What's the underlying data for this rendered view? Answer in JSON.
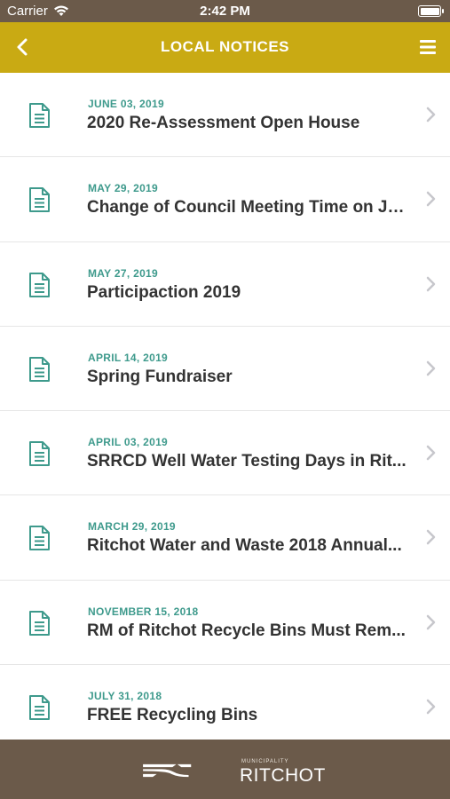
{
  "status_bar": {
    "carrier": "Carrier",
    "time": "2:42 PM"
  },
  "header": {
    "title": "LOCAL NOTICES",
    "back_icon": "chevron-left-icon",
    "menu_icon": "hamburger-menu-icon"
  },
  "notices": [
    {
      "date": "JUNE 03, 2019",
      "title": "2020 Re-Assessment Open House"
    },
    {
      "date": "MAY 29, 2019",
      "title": "Change of Council Meeting Time on Ju..."
    },
    {
      "date": "MAY 27, 2019",
      "title": "Participaction 2019"
    },
    {
      "date": "APRIL 14, 2019",
      "title": "Spring Fundraiser"
    },
    {
      "date": "APRIL 03, 2019",
      "title": "SRRCD Well Water Testing Days in Rit..."
    },
    {
      "date": "MARCH 29, 2019",
      "title": "Ritchot Water and Waste 2018 Annual..."
    },
    {
      "date": "NOVEMBER 15, 2018",
      "title": "RM of Ritchot Recycle Bins Must Rem..."
    },
    {
      "date": "JULY 31, 2018",
      "title": "FREE Recycling Bins"
    }
  ],
  "footer": {
    "logo_top": "MUNICIPALITY",
    "logo_name": "RITCHOT"
  },
  "colors": {
    "header": "#c9aa13",
    "status_bar": "#6b5a4a",
    "date_text": "#3e9a8c",
    "footer": "#6b5a4a"
  }
}
